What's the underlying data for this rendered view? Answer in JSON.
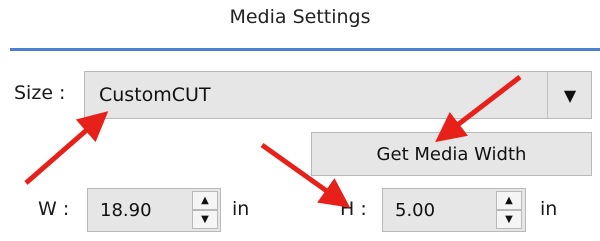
{
  "window": {
    "title": "Media Settings",
    "accent_color": "#4a7fd0"
  },
  "size": {
    "label": "Size :",
    "value": "CustomCUT",
    "dropdown_icon": "triangle-down-icon"
  },
  "get_media_width_button": "Get Media Width",
  "width": {
    "label": "W :",
    "value": "18.90",
    "unit": "in"
  },
  "height": {
    "label": "H :",
    "value": "5.00",
    "unit": "in"
  },
  "annotations": {
    "arrow_color": "#e8201a",
    "arrow_icon": "red-annotation-arrow"
  }
}
